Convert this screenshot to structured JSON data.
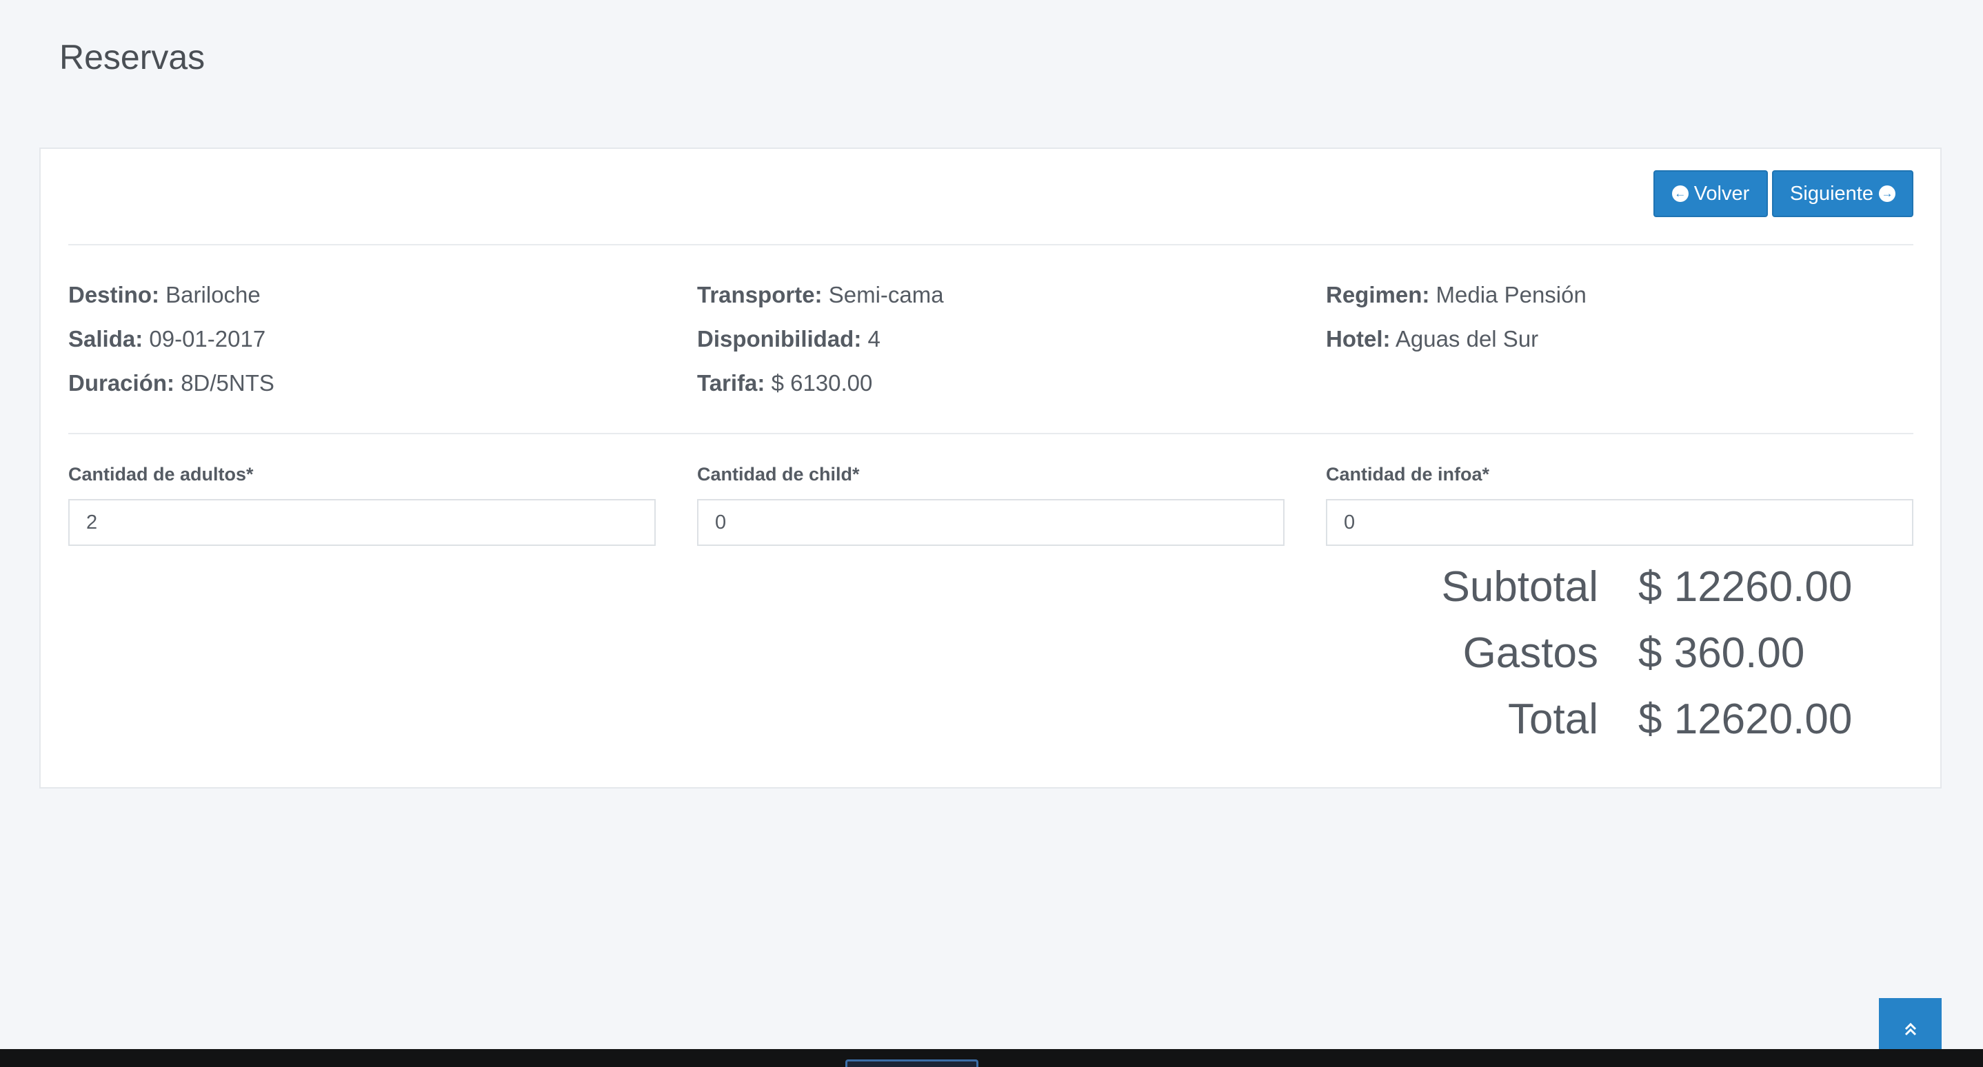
{
  "page": {
    "title": "Reservas"
  },
  "actions": {
    "back_label": "Volver",
    "next_label": "Siguiente"
  },
  "info": {
    "col1": [
      {
        "label": "Destino:",
        "value": "Bariloche"
      },
      {
        "label": "Salida:",
        "value": "09-01-2017"
      },
      {
        "label": "Duración:",
        "value": "8D/5NTS"
      }
    ],
    "col2": [
      {
        "label": "Transporte:",
        "value": "Semi-cama"
      },
      {
        "label": "Disponibilidad:",
        "value": "4"
      },
      {
        "label": "Tarifa:",
        "value": "$ 6130.00"
      }
    ],
    "col3": [
      {
        "label": "Regimen:",
        "value": "Media Pensión"
      },
      {
        "label": "Hotel:",
        "value": "Aguas del Sur"
      }
    ]
  },
  "form": {
    "adults": {
      "label": "Cantidad de adultos*",
      "value": "2"
    },
    "children": {
      "label": "Cantidad de child*",
      "value": "0"
    },
    "infants": {
      "label": "Cantidad de infoa*",
      "value": "0"
    }
  },
  "totals": {
    "subtotal": {
      "label": "Subtotal",
      "value": "$ 12260.00"
    },
    "gastos": {
      "label": "Gastos",
      "value": "$ 360.00"
    },
    "total": {
      "label": "Total",
      "value": "$ 12620.00"
    }
  },
  "colors": {
    "accent": "#2683c8",
    "background": "#f4f6f9",
    "text": "#555b63"
  },
  "icons": {
    "back": "arrow-circle-left-icon",
    "next": "arrow-circle-right-icon",
    "scroll_top": "double-chevron-up-icon"
  }
}
